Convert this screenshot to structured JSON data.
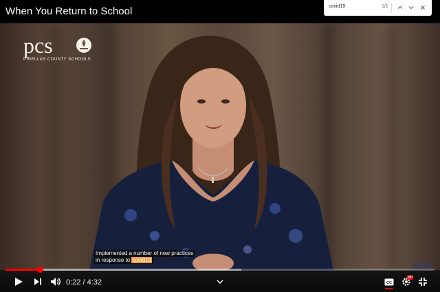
{
  "window": {
    "title": "When You Return to School"
  },
  "find_bar": {
    "query": "covid19",
    "count": "1/1"
  },
  "video": {
    "logo_text": "pcs",
    "logo_subtitle": "PINELLAS COUNTY SCHOOLS",
    "caption": {
      "line1": "Implemented a number of new practices",
      "line2_prefix": "in response to ",
      "line2_highlight": "covid19"
    }
  },
  "player": {
    "current_time": "0:22",
    "separator": " / ",
    "duration": "4:32",
    "progress_fraction": 0.081,
    "buffered_fraction": 0.55,
    "hd_badge": "HD",
    "accent_color": "#ff0000"
  },
  "icons": [
    "play-icon",
    "next-icon",
    "volume-icon",
    "chevron-down-icon",
    "captions-icon",
    "settings-icon",
    "exit-fullscreen-icon",
    "chevron-up-icon",
    "close-icon"
  ]
}
